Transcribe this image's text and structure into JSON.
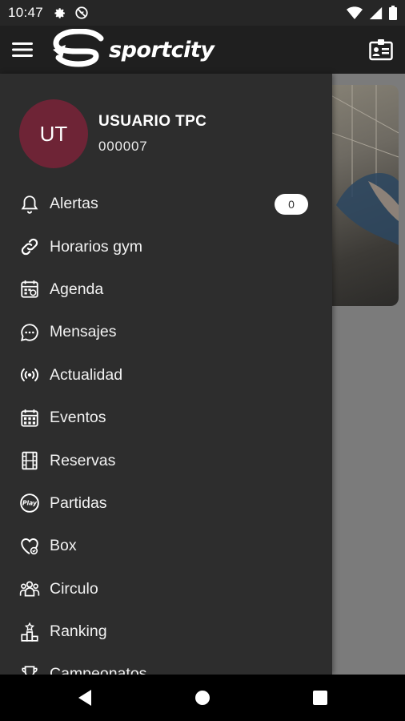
{
  "status_bar": {
    "time": "10:47",
    "left_icons": [
      "settings-icon",
      "do-not-disturb-icon"
    ],
    "right_icons": [
      "wifi-icon",
      "signal-icon",
      "battery-icon"
    ]
  },
  "app_bar": {
    "brand": "sportcity",
    "left_icon": "hamburger-menu-icon",
    "right_icon": "id-card-icon"
  },
  "drawer": {
    "user": {
      "initials": "UT",
      "name": "USUARIO TPC",
      "id": "000007",
      "avatar_color": "#6e2436"
    },
    "items": [
      {
        "label": "Alertas",
        "icon": "bell-icon",
        "badge": "0"
      },
      {
        "label": "Horarios gym",
        "icon": "link-icon"
      },
      {
        "label": "Agenda",
        "icon": "calendar-icon"
      },
      {
        "label": "Mensajes",
        "icon": "chat-bubble-icon"
      },
      {
        "label": "Actualidad",
        "icon": "broadcast-icon"
      },
      {
        "label": "Eventos",
        "icon": "calendar-grid-icon"
      },
      {
        "label": "Reservas",
        "icon": "film-strip-icon"
      },
      {
        "label": "Partidas",
        "icon": "play-badge-icon"
      },
      {
        "label": "Box",
        "icon": "heart-check-icon"
      },
      {
        "label": "Circulo",
        "icon": "group-icon"
      },
      {
        "label": "Ranking",
        "icon": "podium-icon"
      },
      {
        "label": "Campeonatos",
        "icon": "trophy-icon"
      }
    ]
  },
  "colors": {
    "drawer_bg": "#2d2d2d",
    "app_bar_bg": "#1f1f1f",
    "scrim": "#7b7b7b",
    "accent": "#6e2436"
  },
  "nav_bar": {
    "buttons": [
      "back-icon",
      "home-icon",
      "recents-icon"
    ]
  }
}
